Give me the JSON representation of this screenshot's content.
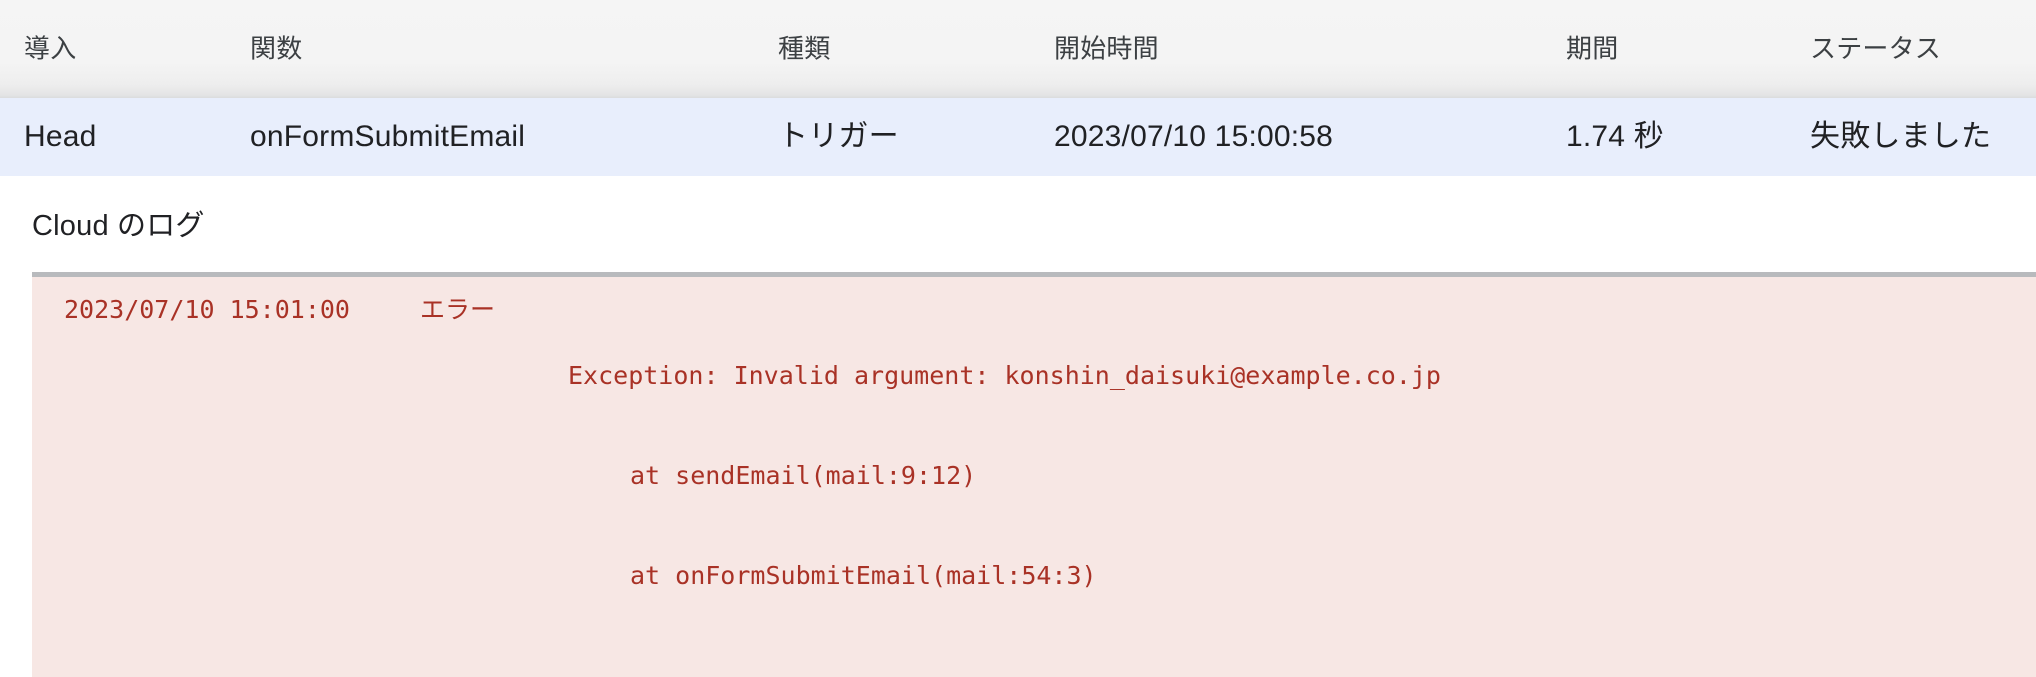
{
  "table": {
    "columns": [
      {
        "key": "deployment",
        "label": "導入"
      },
      {
        "key": "function",
        "label": "関数"
      },
      {
        "key": "type",
        "label": "種類"
      },
      {
        "key": "start_time",
        "label": "開始時間"
      },
      {
        "key": "duration",
        "label": "期間"
      },
      {
        "key": "status",
        "label": "ステータス"
      }
    ],
    "rows": [
      {
        "deployment": "Head",
        "function": "onFormSubmitEmail",
        "type": "トリガー",
        "start_time": "2023/07/10 15:00:58",
        "duration": "1.74 秒",
        "status": "失敗しました",
        "status_color": "#c5221f",
        "selected": true
      }
    ]
  },
  "logs": {
    "title": "Cloud のログ",
    "entries": [
      {
        "timestamp": "2023/07/10 15:01:00",
        "level": "エラー",
        "message_lines": [
          "Exception: Invalid argument: konshin_daisuki@example.co.jp",
          "at sendEmail(mail:9:12)",
          "at onFormSubmitEmail(mail:54:3)"
        ]
      }
    ]
  },
  "colors": {
    "header_background": "#f4f4f4",
    "selected_row_background": "#e8eefc",
    "log_panel_background": "#f7e7e4",
    "log_panel_border": "#b8babd",
    "log_text": "#a93226",
    "error_text": "#c5221f",
    "primary_text": "#202124"
  }
}
